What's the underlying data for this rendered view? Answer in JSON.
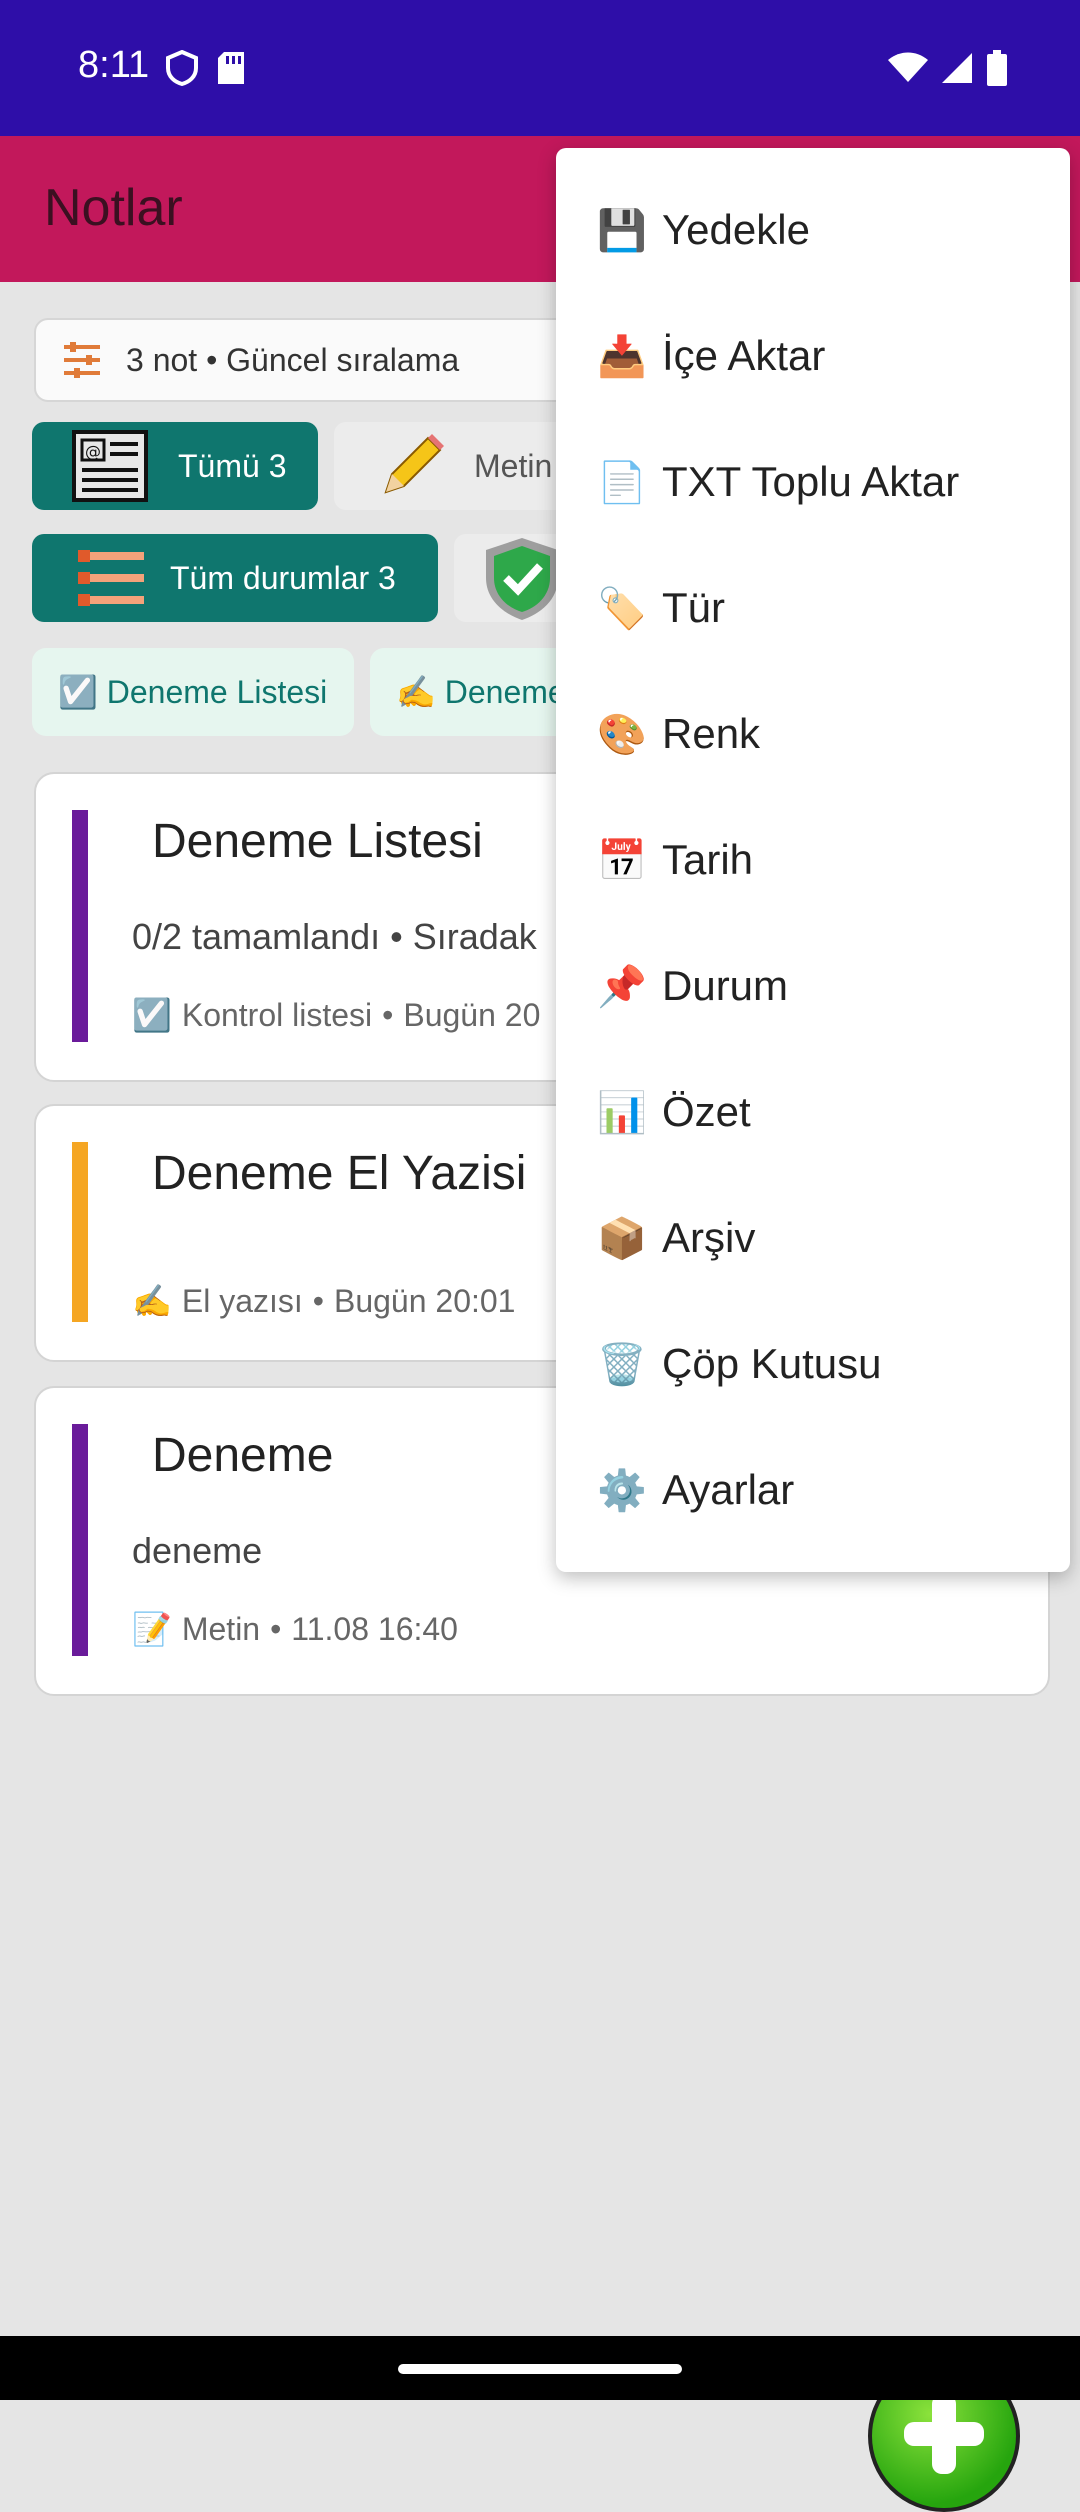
{
  "status_bar": {
    "time": "8:11"
  },
  "app_bar": {
    "title": "Notlar"
  },
  "summary": {
    "text": "3 not • Güncel sıralama"
  },
  "type_filters": [
    {
      "label": "Tümü 3"
    },
    {
      "label": "Metin"
    }
  ],
  "status_filters": [
    {
      "label": "Tüm durumlar 3"
    }
  ],
  "tag_chips": [
    {
      "label": "☑️ Deneme Listesi"
    },
    {
      "label": "✍️ Deneme"
    }
  ],
  "notes": [
    {
      "title": "Deneme Listesi",
      "body": "0/2 tamamlandı • Sıradak",
      "meta_icon": "☑️",
      "meta_type": "Kontrol listesi",
      "meta_date": "Bugün 20",
      "accent_color": "#6a1b9a"
    },
    {
      "title": "Deneme El Yazisi",
      "body": "",
      "meta_icon": "✍️",
      "meta_type": "El yazısı",
      "meta_date": "Bugün 20:01",
      "accent_color": "#f5a623"
    },
    {
      "title": "Deneme",
      "body": "deneme",
      "meta_icon": "📝",
      "meta_type": "Metin",
      "meta_date": "11.08 16:40",
      "accent_color": "#6a1b9a"
    }
  ],
  "menu": {
    "items": [
      {
        "emoji": "💾",
        "label": "Yedekle"
      },
      {
        "emoji": "📥",
        "label": "İçe Aktar"
      },
      {
        "emoji": "📄",
        "label": "TXT Toplu Aktar"
      },
      {
        "emoji": "🏷️",
        "label": "Tür"
      },
      {
        "emoji": "🎨",
        "label": "Renk"
      },
      {
        "emoji": "📅",
        "label": "Tarih"
      },
      {
        "emoji": "📌",
        "label": "Durum"
      },
      {
        "emoji": "📊",
        "label": "Özet"
      },
      {
        "emoji": "📦",
        "label": "Arşiv"
      },
      {
        "emoji": "🗑️",
        "label": "Çöp Kutusu"
      },
      {
        "emoji": "⚙️",
        "label": "Ayarlar"
      }
    ]
  },
  "colors": {
    "status_bar": "#2e0ea8",
    "app_bar": "#c2185b",
    "chip_active": "#0f766e",
    "fab": "#2ea514"
  }
}
